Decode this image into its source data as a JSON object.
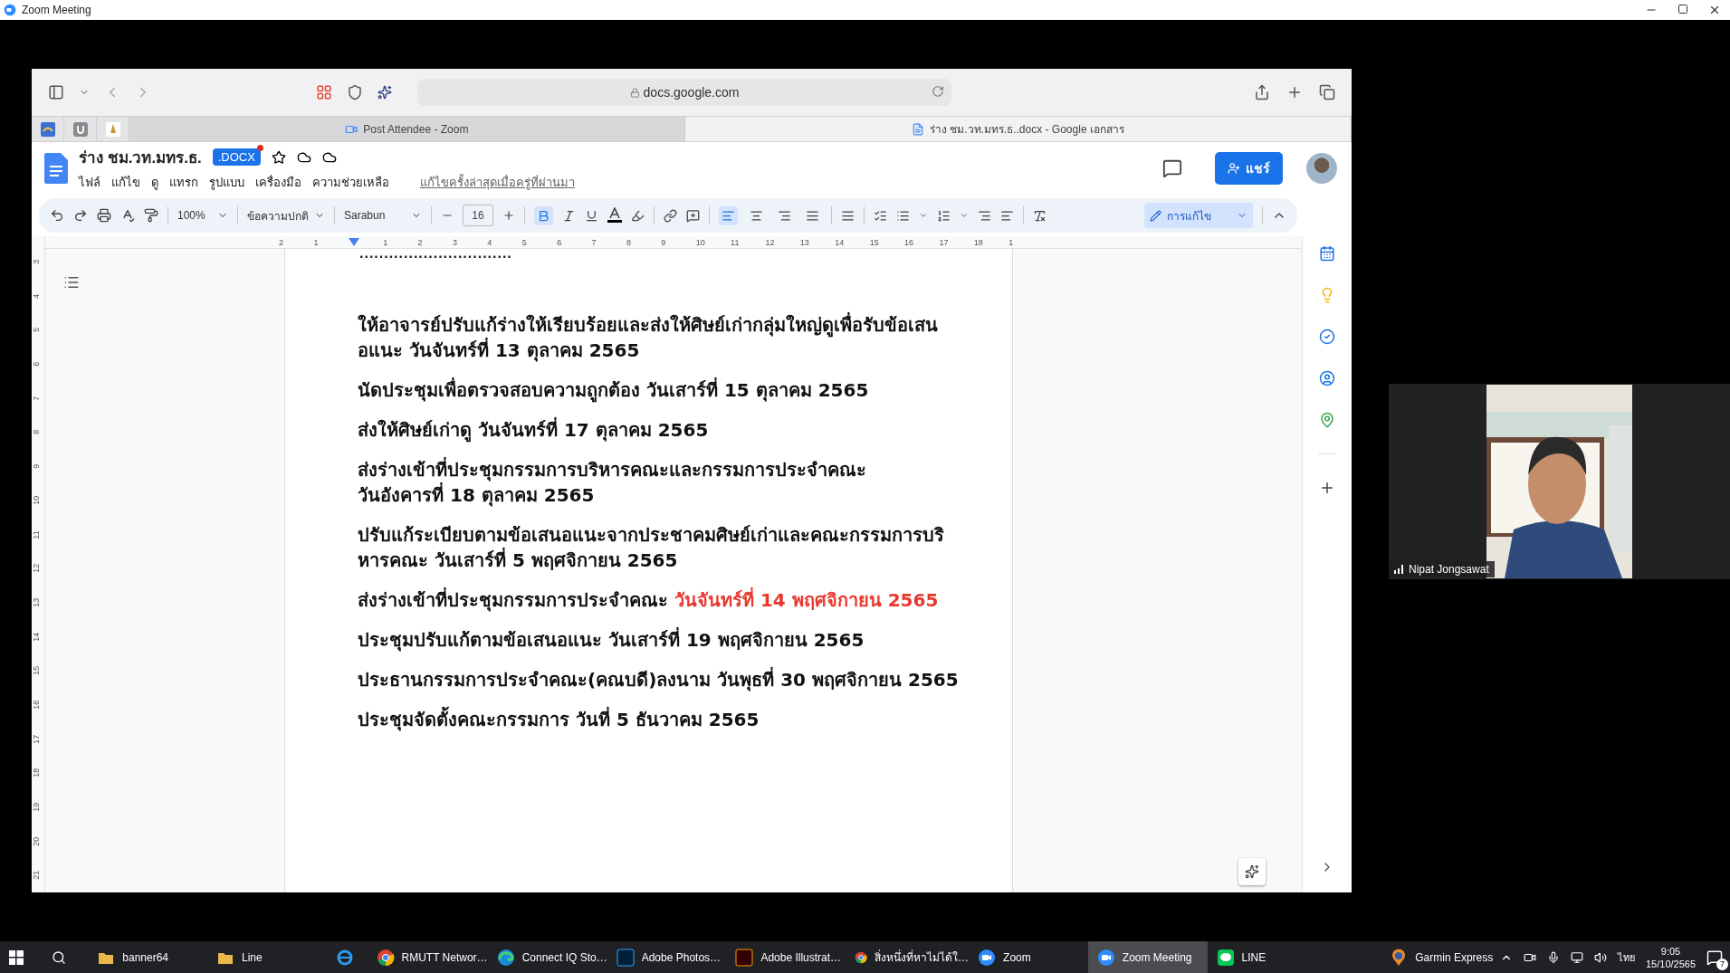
{
  "zoom_window": {
    "title": "Zoom Meeting"
  },
  "browser": {
    "url": "docs.google.com",
    "tabs": [
      {
        "title": "Post Attendee - Zoom",
        "kind": "zoom",
        "selected": false
      },
      {
        "title": "ร่าง ชม.วท.มทร.ธ..docx - Google เอกสาร",
        "kind": "docs",
        "selected": true
      }
    ]
  },
  "docs": {
    "title": "ร่าง ชม.วท.มทร.ธ.",
    "badge": ".DOCX",
    "menus": [
      "ไฟล์",
      "แก้ไข",
      "ดู",
      "แทรก",
      "รูปแบบ",
      "เครื่องมือ",
      "ความช่วยเหลือ"
    ],
    "last_edit": "แก้ไขครั้งล่าสุดเมื่อครู่ที่ผ่านมา",
    "share": "แชร์",
    "toolbar": {
      "zoom": "100%",
      "style": "ข้อความปกติ",
      "font": "Sarabun",
      "font_size": "16",
      "bold": true,
      "align": [
        {
          "kind": "left",
          "selected": true
        },
        {
          "kind": "center",
          "selected": false
        },
        {
          "kind": "right",
          "selected": false
        },
        {
          "kind": "justify",
          "selected": false
        }
      ],
      "mode": "การแก้ไข"
    },
    "ruler_h": [
      "2",
      "1",
      "1",
      "2",
      "3",
      "4",
      "5",
      "6",
      "7",
      "8",
      "9",
      "10",
      "11",
      "12",
      "13",
      "14",
      "15",
      "16",
      "17",
      "18",
      "1"
    ],
    "ruler_v": [
      "3",
      "4",
      "5",
      "6",
      "7",
      "8",
      "9",
      "10",
      "11",
      "12",
      "13",
      "14",
      "15",
      "16",
      "17",
      "18",
      "19",
      "20",
      "21"
    ],
    "dotted_line": "...............................",
    "paragraphs": [
      {
        "lines": [
          [
            {
              "text": "ให้อาจารย์ปรับแก้ร่างให้เรียบร้อยและส่งให้ศิษย์เก่ากลุ่มใหญ่ดูเพื่อรับข้อเสน"
            }
          ],
          [
            {
              "text": "อแนะ วันจันทร์ที่ 13 ตุลาคม 2565"
            }
          ]
        ]
      },
      {
        "lines": [
          [
            {
              "text": "นัดประชุมเพื่อตรวจสอบความถูกต้อง วันเสาร์ที่ 15 ตุลาคม 2565"
            }
          ]
        ]
      },
      {
        "lines": [
          [
            {
              "text": "ส่งให้ศิษย์เก่าดู วันจันทร์ที่ 17 ตุลาคม 2565"
            }
          ]
        ]
      },
      {
        "lines": [
          [
            {
              "text": "ส่งร่างเข้าที่ประชุมกรรมการบริหารคณะและกรรมการประจำคณะ"
            }
          ],
          [
            {
              "text": "วันอังคารที่ 18 ตุลาคม 2565"
            }
          ]
        ]
      },
      {
        "lines": [
          [
            {
              "text": "ปรับแก้ระเบียบตามข้อเสนอแนะจากประชาคมศิษย์เก่าและคณะกรรมการบริ"
            }
          ],
          [
            {
              "text": "หารคณะ วันเสาร์ที่ 5 พฤศจิกายน 2565"
            }
          ]
        ]
      },
      {
        "lines": [
          [
            {
              "text": "ส่งร่างเข้าที่ประชุมกรรมการประจำคณะ "
            },
            {
              "text": "วันจันทร์ที่ 14 พฤศจิกายน 2565",
              "color": "#e8382f"
            }
          ]
        ]
      },
      {
        "lines": [
          [
            {
              "text": "ประชุมปรับแก้ตามข้อเสนอแนะ วันเสาร์ที่ 19 พฤศจิกายน 2565"
            }
          ]
        ]
      },
      {
        "lines": [
          [
            {
              "text": "ประธานกรรมการประจำคณะ(คณบดี)ลงนาม วันพุธที่ 30 พฤศจิกายน 2565"
            }
          ]
        ]
      },
      {
        "lines": [
          [
            {
              "text": "ประชุมจัดตั้งคณะกรรมการ วันที่ 5 ธันวาคม 2565"
            }
          ]
        ]
      }
    ]
  },
  "video": {
    "name": "Nipat Jongsawat"
  },
  "taskbar": {
    "items": [
      {
        "label": "banner64",
        "kind": "folder",
        "selected": false
      },
      {
        "label": "Line",
        "kind": "folder",
        "selected": false
      },
      {
        "kind": "ie",
        "selected": false
      },
      {
        "label": "RMUTT Networ…",
        "kind": "chrome",
        "selected": false
      },
      {
        "label": "Connect IQ Sto…",
        "kind": "edge",
        "selected": false
      },
      {
        "label": "Adobe Photos…",
        "kind": "ps",
        "selected": false
      },
      {
        "label": "Adobe Illustrat…",
        "kind": "ai",
        "selected": false
      },
      {
        "label": "สิ่งหนึ่งที่หาไม่ได้ใ…",
        "kind": "chrome",
        "selected": false
      },
      {
        "label": "Zoom",
        "kind": "zoom",
        "selected": false
      },
      {
        "label": "Zoom Meeting",
        "kind": "zoom",
        "selected": true
      },
      {
        "label": "LINE",
        "kind": "line",
        "selected": false
      },
      {
        "label": "Garmin Express",
        "kind": "garmin",
        "selected": false
      }
    ],
    "language": "ไทย",
    "time": "9:05",
    "date": "15/10/2565",
    "notifications": "7"
  }
}
